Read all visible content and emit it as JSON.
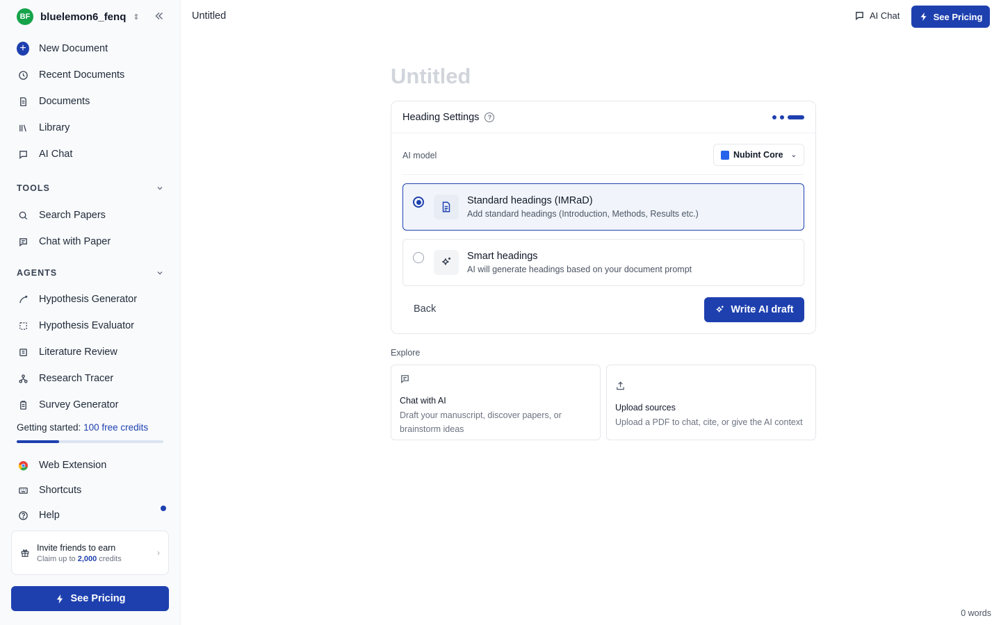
{
  "account": {
    "initials": "BF",
    "name": "bluelemon6_fenq"
  },
  "nav": {
    "new_document": "New Document",
    "recent_documents": "Recent Documents",
    "documents": "Documents",
    "library": "Library",
    "ai_chat": "AI Chat"
  },
  "tools": {
    "heading": "TOOLS",
    "search_papers": "Search Papers",
    "chat_with_paper": "Chat with Paper"
  },
  "agents": {
    "heading": "AGENTS",
    "items": [
      "Hypothesis Generator",
      "Hypothesis Evaluator",
      "Literature Review",
      "Research Tracer",
      "Survey Generator"
    ]
  },
  "credits": {
    "prefix": "Getting started:",
    "link": "100 free credits",
    "progress": 0.29
  },
  "footer_nav": {
    "web_extension": "Web Extension",
    "shortcuts": "Shortcuts",
    "help": "Help"
  },
  "invite": {
    "title": "Invite friends to earn",
    "sub_prefix": "Claim up to",
    "amount": "2,000",
    "sub_suffix": "credits"
  },
  "sidebar_pricing": "See Pricing",
  "topbar": {
    "doc_tab": "Untitled",
    "ai_chat": "AI Chat",
    "pricing": "See Pricing"
  },
  "doc_title": "Untitled",
  "heading_settings": {
    "title": "Heading Settings",
    "model_label": "AI model",
    "model_value": "Nubint Core",
    "options": [
      {
        "title": "Standard headings (IMRaD)",
        "sub": "Add standard headings (Introduction, Methods, Results etc.)",
        "selected": true
      },
      {
        "title": "Smart headings",
        "sub": "AI will generate headings based on your document prompt",
        "selected": false
      }
    ],
    "back": "Back",
    "write": "Write AI draft"
  },
  "explore": {
    "heading": "Explore",
    "cards": [
      {
        "title": "Chat with AI",
        "sub": "Draft your manuscript, discover papers, or brainstorm ideas"
      },
      {
        "title": "Upload sources",
        "sub": "Upload a PDF to chat, cite, or give the AI context"
      }
    ]
  },
  "word_count": "0 words",
  "colors": {
    "accent": "#1e40af",
    "avatar": "#16a34a"
  }
}
